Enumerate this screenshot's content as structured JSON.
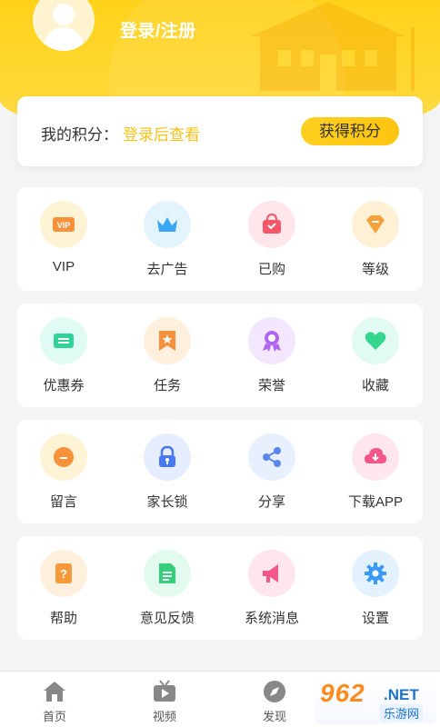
{
  "header": {
    "login_text": "登录/注册"
  },
  "points": {
    "label": "我的积分：",
    "value": "登录后查看",
    "button": "获得积分"
  },
  "grid": [
    {
      "label": "VIP",
      "icon": "vip-icon",
      "bg": "#fff3d6",
      "color": "#f7913a"
    },
    {
      "label": "去广告",
      "icon": "crown-icon",
      "bg": "#e4f4ff",
      "color": "#3aa7f5"
    },
    {
      "label": "已购",
      "icon": "bag-icon",
      "bg": "#ffe6ea",
      "color": "#f5566a"
    },
    {
      "label": "等级",
      "icon": "diamond-icon",
      "bg": "#fff0d6",
      "color": "#f7a13a"
    },
    {
      "label": "优惠券",
      "icon": "coupon-icon",
      "bg": "#e0fbf3",
      "color": "#2fd39a"
    },
    {
      "label": "任务",
      "icon": "bookmark-icon",
      "bg": "#fff0de",
      "color": "#f5913a"
    },
    {
      "label": "荣誉",
      "icon": "medal-icon",
      "bg": "#f3e6ff",
      "color": "#b064f2"
    },
    {
      "label": "收藏",
      "icon": "heart-icon",
      "bg": "#e2fbf2",
      "color": "#34d58f"
    },
    {
      "label": "留言",
      "icon": "message-icon",
      "bg": "#fff3d6",
      "color": "#f7913a"
    },
    {
      "label": "家长锁",
      "icon": "lock-icon",
      "bg": "#e6edff",
      "color": "#4a78f0"
    },
    {
      "label": "分享",
      "icon": "share-icon",
      "bg": "#e8efff",
      "color": "#5a86f0"
    },
    {
      "label": "下载APP",
      "icon": "download-cloud-icon",
      "bg": "#ffe6ef",
      "color": "#f5568a"
    },
    {
      "label": "帮助",
      "icon": "help-book-icon",
      "bg": "#fff0de",
      "color": "#f59a3a"
    },
    {
      "label": "意见反馈",
      "icon": "document-icon",
      "bg": "#e2fbee",
      "color": "#34cf78"
    },
    {
      "label": "系统消息",
      "icon": "megaphone-icon",
      "bg": "#ffe6ee",
      "color": "#f5568a"
    },
    {
      "label": "设置",
      "icon": "gear-icon",
      "bg": "#e4f2ff",
      "color": "#3a9af5"
    }
  ],
  "tabbar": [
    {
      "label": "首页",
      "icon": "home-icon"
    },
    {
      "label": "视频",
      "icon": "tv-icon"
    },
    {
      "label": "发现",
      "icon": "compass-icon"
    }
  ],
  "watermark": {
    "big": "962",
    "net": ".NET",
    "sub": "乐游网"
  }
}
